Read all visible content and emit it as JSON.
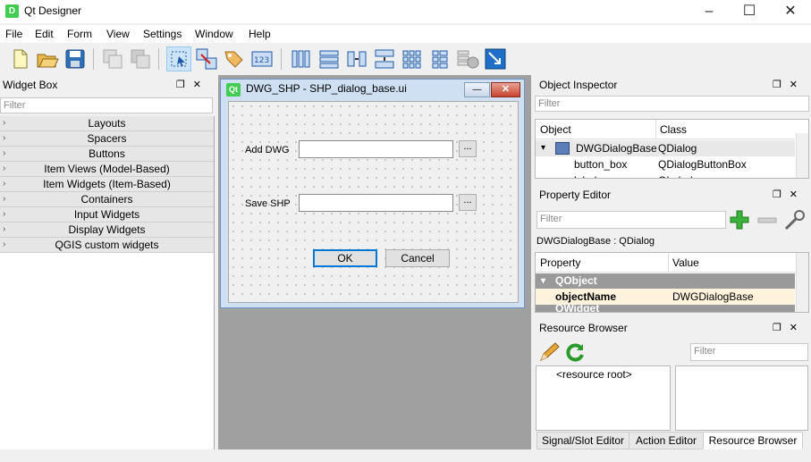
{
  "window": {
    "title": "Qt Designer",
    "app_icon": "D"
  },
  "window_controls": {
    "minimize": "–",
    "maximize": "☐",
    "close": "✕"
  },
  "menu": [
    "File",
    "Edit",
    "Form",
    "View",
    "Settings",
    "Window",
    "Help"
  ],
  "widget_box": {
    "title": "Widget Box",
    "filter_placeholder": "Filter",
    "categories": [
      "Layouts",
      "Spacers",
      "Buttons",
      "Item Views (Model-Based)",
      "Item Widgets (Item-Based)",
      "Containers",
      "Input Widgets",
      "Display Widgets",
      "QGIS custom widgets"
    ]
  },
  "panel_buttons": "❐✕",
  "dialog": {
    "qt_icon": "Qt",
    "title": "DWG_SHP - SHP_dialog_base.ui",
    "add_label": "Add DWG",
    "save_label": "Save SHP",
    "browse": "...",
    "ok": "OK",
    "cancel": "Cancel",
    "close_glyph": "✕",
    "min_glyph": "—"
  },
  "object_inspector": {
    "title": "Object Inspector",
    "filter_placeholder": "Filter",
    "col_object": "Object",
    "col_class": "Class",
    "rows": [
      {
        "object": "DWGDialogBase",
        "class": "QDialog"
      },
      {
        "object": "button_box",
        "class": "QDialogButtonBox"
      },
      {
        "object": "label",
        "class": "QLabel"
      }
    ]
  },
  "property_editor": {
    "title": "Property Editor",
    "filter_placeholder": "Filter",
    "context": "DWGDialogBase : QDialog",
    "col_property": "Property",
    "col_value": "Value",
    "group": "QObject",
    "next_group": "QWidget",
    "row_name": "objectName",
    "row_value": "DWGDialogBase"
  },
  "resource_browser": {
    "title": "Resource Browser",
    "filter_placeholder": "Filter",
    "root": "<resource root>"
  },
  "tabs": [
    "Signal/Slot Editor",
    "Action Editor",
    "Resource Browser"
  ],
  "colors": {
    "qt_green": "#41cd52",
    "selection": "#cce4f7"
  }
}
